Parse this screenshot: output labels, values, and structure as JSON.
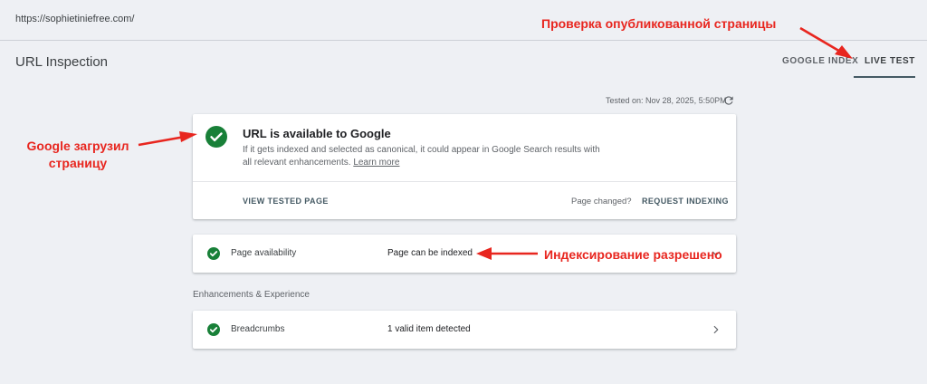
{
  "url_bar": {
    "url": "https://sophietiniefree.com/"
  },
  "header": {
    "title": "URL Inspection",
    "tabs": [
      {
        "label": "GOOGLE INDEX",
        "active": false
      },
      {
        "label": "LIVE TEST",
        "active": true
      }
    ]
  },
  "tested_on": "Tested on: Nov 28, 2025, 5:50PM",
  "main_card": {
    "title": "URL is available to Google",
    "description": "If it gets indexed and selected as canonical, it could appear in Google Search results with all relevant enhancements.",
    "learn_more": "Learn more",
    "view_tested_page": "VIEW TESTED PAGE",
    "page_changed": "Page changed?",
    "request_indexing": "REQUEST INDEXING"
  },
  "availability": {
    "label": "Page availability",
    "value": "Page can be indexed"
  },
  "enhancements": {
    "section_label": "Enhancements & Experience",
    "items": [
      {
        "label": "Breadcrumbs",
        "value": "1 valid item detected"
      }
    ]
  },
  "annotations": {
    "live_test": "Проверка опубликованной страницы",
    "loaded_line1": "Google загрузил",
    "loaded_line2": "страницу",
    "indexing": "Индексирование разрешено"
  },
  "colors": {
    "success_green": "#188038",
    "annotation_red": "#e8261f",
    "tab_underline": "#455a64",
    "background": "#eef0f4"
  },
  "icons": {
    "status": "check-circle-icon",
    "refresh": "refresh-icon",
    "expand": "chevron-down-icon",
    "open": "chevron-right-icon"
  }
}
